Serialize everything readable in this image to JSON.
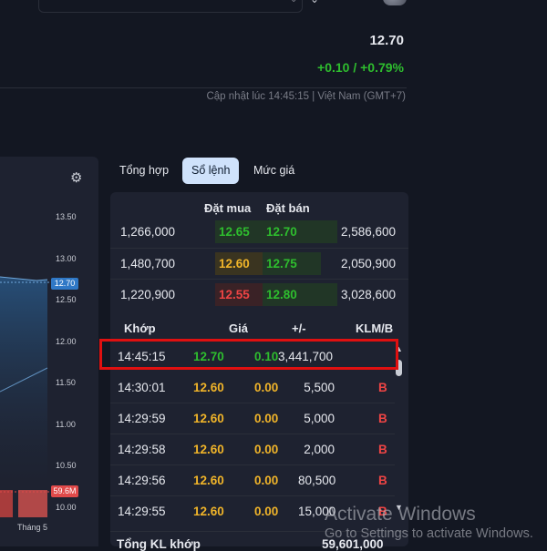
{
  "header": {
    "price": "12.70",
    "change": "+0.10 / +0.79%",
    "update_text": "Cập nhật lúc 14:45:15 | Việt Nam (GMT+7)"
  },
  "colors": {
    "up": "#2ebd2e",
    "ref": "#f0b429",
    "down": "#ef4444",
    "background": "#131722",
    "panel": "#1e2230",
    "highlight": "#e01010"
  },
  "chart": {
    "y_ticks": [
      "13.50",
      "13.00",
      "12.50",
      "12.00",
      "11.50",
      "11.00",
      "10.50",
      "10.00"
    ],
    "current_price_tag": "12.70",
    "volume_tag": "59.6M",
    "x_label": "Tháng 5",
    "settings_icon": "gear-icon"
  },
  "tabs": [
    {
      "label": "Tổng hợp",
      "active": false
    },
    {
      "label": "Sổ lệnh",
      "active": true
    },
    {
      "label": "Mức giá",
      "active": false
    }
  ],
  "order_book": {
    "buy_header": "Đặt mua",
    "sell_header": "Đặt bán",
    "rows": [
      {
        "buy_vol": "1,266,000",
        "buy_price": "12.65",
        "sell_price": "12.70",
        "sell_vol": "2,586,600"
      },
      {
        "buy_vol": "1,480,700",
        "buy_price": "12.60",
        "sell_price": "12.75",
        "sell_vol": "2,050,900"
      },
      {
        "buy_vol": "1,220,900",
        "buy_price": "12.55",
        "sell_price": "12.80",
        "sell_vol": "3,028,600"
      }
    ]
  },
  "matches": {
    "headers": {
      "time": "Khớp",
      "price": "Giá",
      "change": "+/-",
      "volume": "KLM/B"
    },
    "rows": [
      {
        "time": "14:45:15",
        "price": "12.70",
        "change": "0.10",
        "volume": "3,441,700",
        "side": ""
      },
      {
        "time": "14:30:01",
        "price": "12.60",
        "change": "0.00",
        "volume": "5,500",
        "side": "B"
      },
      {
        "time": "14:29:59",
        "price": "12.60",
        "change": "0.00",
        "volume": "5,000",
        "side": "B"
      },
      {
        "time": "14:29:58",
        "price": "12.60",
        "change": "0.00",
        "volume": "2,000",
        "side": "B"
      },
      {
        "time": "14:29:56",
        "price": "12.60",
        "change": "0.00",
        "volume": "80,500",
        "side": "B"
      },
      {
        "time": "14:29:55",
        "price": "12.60",
        "change": "0.00",
        "volume": "15,000",
        "side": "B"
      }
    ],
    "total_label": "Tổng KL khớp",
    "total_value": "59,601,000"
  },
  "watermark": {
    "line1": "Activate Windows",
    "line2": "Go to Settings to activate Windows."
  }
}
